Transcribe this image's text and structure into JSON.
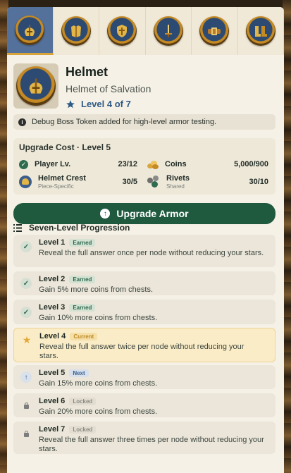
{
  "tabs": [
    {
      "name": "helmet",
      "active": true
    },
    {
      "name": "chestplate",
      "active": false
    },
    {
      "name": "shield",
      "active": false
    },
    {
      "name": "sword",
      "active": false
    },
    {
      "name": "belt",
      "active": false
    },
    {
      "name": "boots",
      "active": false
    }
  ],
  "item": {
    "title": "Helmet",
    "subtitle": "Helmet of Salvation",
    "level_text": "Level 4 of 7"
  },
  "notice": {
    "text": "Debug Boss Token added for high-level armor testing."
  },
  "upgrade_cost": {
    "title": "Upgrade Cost · Level 5",
    "requirements": [
      {
        "name": "Player Lv.",
        "value": "23/12",
        "sub": ""
      },
      {
        "name": "Coins",
        "value": "5,000/900",
        "sub": ""
      },
      {
        "name": "Helmet Crest",
        "value": "30/5",
        "sub": "Piece-Specific"
      },
      {
        "name": "Rivets",
        "value": "30/10",
        "sub": "Shared"
      }
    ]
  },
  "upgrade_button": {
    "label": "Upgrade Armor"
  },
  "progression": {
    "title": "Seven-Level Progression",
    "levels": [
      {
        "title": "Level 1",
        "status": "Earned",
        "desc": "Reveal the full answer once per node without reducing your stars."
      },
      {
        "title": "Level 2",
        "status": "Earned",
        "desc": "Gain 5% more coins from chests."
      },
      {
        "title": "Level 3",
        "status": "Earned",
        "desc": "Gain 10% more coins from chests."
      },
      {
        "title": "Level 4",
        "status": "Current",
        "desc": "Reveal the full answer twice per node without reducing your stars."
      },
      {
        "title": "Level 5",
        "status": "Next",
        "desc": "Gain 15% more coins from chests."
      },
      {
        "title": "Level 6",
        "status": "Locked",
        "desc": "Gain 20% more coins from chests."
      },
      {
        "title": "Level 7",
        "status": "Locked",
        "desc": "Reveal the full answer three times per node without reducing your stars."
      }
    ]
  },
  "colors": {
    "primary": "#1f5a3f",
    "accent": "#d9a43a",
    "level_text": "#2d5a86"
  }
}
